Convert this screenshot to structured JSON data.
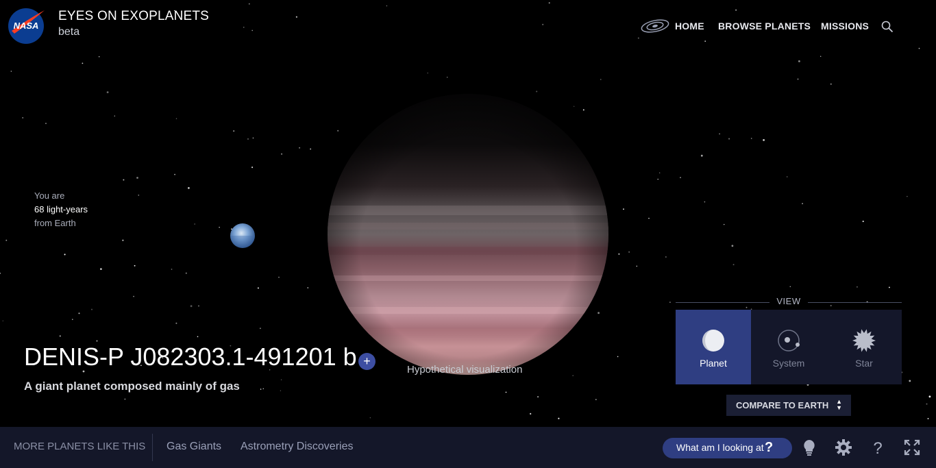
{
  "header": {
    "logo_text": "NASA",
    "title": "EYES ON EXOPLANETS",
    "subtitle": "beta",
    "nav": [
      {
        "label": "HOME"
      },
      {
        "label": "BROWSE PLANETS"
      },
      {
        "label": "MISSIONS"
      }
    ],
    "icons": {
      "home": "galaxy-icon",
      "search": "search-icon"
    }
  },
  "distance": {
    "line1": "You are",
    "line2": "68 light-years",
    "line3": "from Earth"
  },
  "planet": {
    "name": "DENIS-P J082303.1-491201 b",
    "add_symbol": "+",
    "description": "A giant planet composed mainly of gas",
    "visual_note": "Hypothetical visualization"
  },
  "view": {
    "label": "VIEW",
    "options": [
      {
        "label": "Planet",
        "icon": "planet-icon",
        "active": true
      },
      {
        "label": "System",
        "icon": "system-icon",
        "active": false
      },
      {
        "label": "Star",
        "icon": "star-icon",
        "active": false
      }
    ],
    "compare_label": "COMPARE TO EARTH"
  },
  "bottom_bar": {
    "more_label": "MORE PLANETS LIKE THIS",
    "categories": [
      {
        "label": "Gas Giants"
      },
      {
        "label": "Astrometry Discoveries"
      }
    ],
    "help_button": {
      "label": "What am I looking at",
      "symbol": "?"
    },
    "tools": [
      "lightbulb-icon",
      "gear-icon",
      "help-icon",
      "fullscreen-icon"
    ]
  },
  "colors": {
    "accent": "#2f3e82",
    "panel": "#14172a",
    "bottom_bar": "#141729",
    "space": "#000000"
  }
}
